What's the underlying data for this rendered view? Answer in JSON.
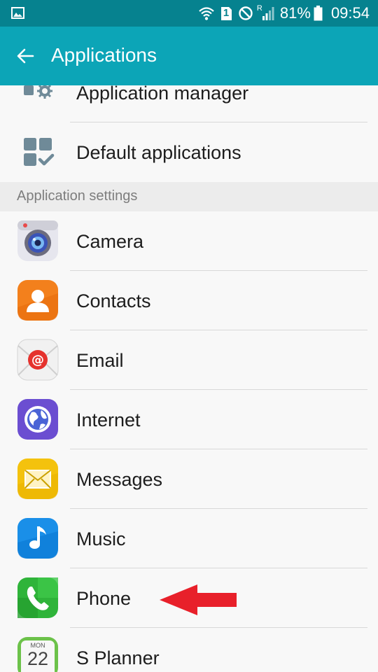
{
  "status_bar": {
    "battery": "81%",
    "time": "09:54",
    "sim_label": "1",
    "roaming_label": "R"
  },
  "action_bar": {
    "title": "Applications"
  },
  "top_items": [
    {
      "label": "Application manager",
      "icon": "application-manager-icon"
    },
    {
      "label": "Default applications",
      "icon": "default-applications-icon"
    }
  ],
  "section_header": "Application settings",
  "apps": [
    {
      "label": "Camera",
      "icon": "camera-icon"
    },
    {
      "label": "Contacts",
      "icon": "contacts-icon"
    },
    {
      "label": "Email",
      "icon": "email-icon"
    },
    {
      "label": "Internet",
      "icon": "internet-icon"
    },
    {
      "label": "Messages",
      "icon": "messages-icon"
    },
    {
      "label": "Music",
      "icon": "music-icon"
    },
    {
      "label": "Phone",
      "icon": "phone-icon"
    },
    {
      "label": "S Planner",
      "icon": "s-planner-icon",
      "cal_day": "MON",
      "cal_date": "22"
    }
  ],
  "colors": {
    "status_bar": "#06828f",
    "action_bar": "#0ca5b7",
    "annotation_arrow": "#e8202a"
  }
}
